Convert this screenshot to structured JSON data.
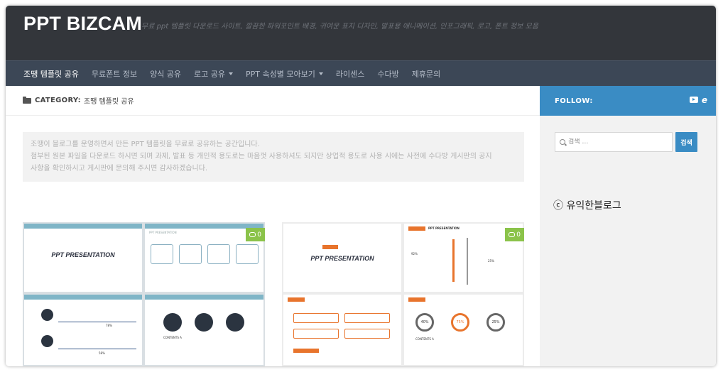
{
  "header": {
    "site_title": "PPT BIZCAM",
    "tagline": "무료 ppt 템플릿 다운로드 사이트, 깔끔한 파워포인트 배경, 귀여운 표지 디자인, 발표용 애니메이션, 인포그래픽, 로고, 폰트 정보 모음"
  },
  "nav": {
    "items": [
      {
        "label": "조땡 템플릿 공유"
      },
      {
        "label": "무료폰트 정보"
      },
      {
        "label": "양식 공유"
      },
      {
        "label": "로고 공유"
      },
      {
        "label": "PPT 속성별 모아보기"
      },
      {
        "label": "라이센스"
      },
      {
        "label": "수다방"
      },
      {
        "label": "제휴문의"
      }
    ]
  },
  "category": {
    "prefix": "CATEGORY:",
    "name": "조땡 템플릿 공유"
  },
  "notice": {
    "line1": "조땡이 블로그를 운영하면서 만든 PPT 템플릿을 무료로 공유하는 공간입니다.",
    "line2": "첨부된 원본 파일을 다운로드 하시면 되며 과제, 발표 등 개인적 용도로는 마음껏 사용하셔도 되지만 상업적 용도로 사용 시에는 사전에 수다방 게시판의 공지",
    "line3": "사항을 확인하시고 게시판에 문의해 주시면 감사하겠습니다."
  },
  "posts": [
    {
      "comment_count": "0",
      "slide_title": "PPT PRESENTATION",
      "slide_header": "PPT PRESENTATION",
      "contents_label": "CONTENTS A",
      "percent_a": "78%",
      "percent_b": "58%"
    },
    {
      "comment_count": "0",
      "slide_title": "PPT PRESENTATION",
      "slide_header": "PPT PRESENTATION",
      "contents_label": "CONTENTS A",
      "percent_a": "92%",
      "percent_b": "25%",
      "donut_values": [
        "40%",
        "75%",
        "25%"
      ]
    }
  ],
  "sidebar": {
    "follow_label": "FOLLOW:",
    "search_placeholder": "검색 …",
    "search_button": "검색"
  },
  "watermark": "ⓒ 유익한블로그",
  "colors": {
    "header_bg": "#33363b",
    "nav_bg": "#3c4756",
    "accent_blue": "#3a8cc4",
    "comment_green": "#8bc34a",
    "slide_orange": "#e8742c"
  }
}
